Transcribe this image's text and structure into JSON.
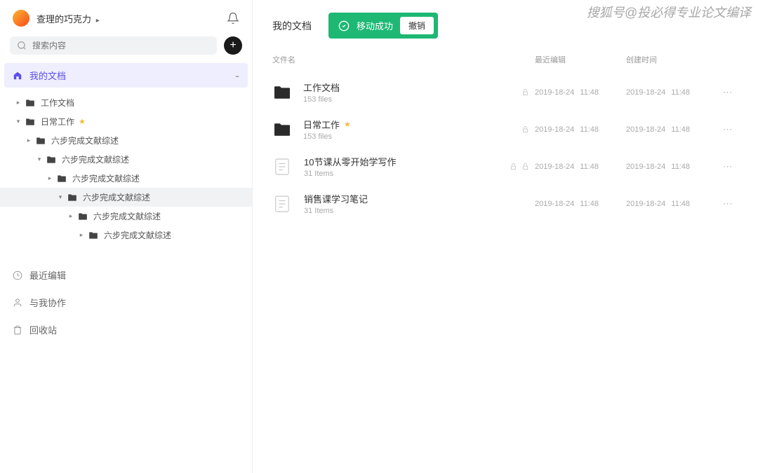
{
  "header": {
    "username": "查理的巧克力",
    "search_placeholder": "搜索内容"
  },
  "nav": {
    "my_docs": "我的文档",
    "recent": "最近编辑",
    "shared": "与我协作",
    "trash": "回收站"
  },
  "tree": [
    {
      "indent": 0,
      "label": "工作文档",
      "expanded": false,
      "starred": false,
      "highlighted": false
    },
    {
      "indent": 0,
      "label": "日常工作",
      "expanded": true,
      "starred": true,
      "highlighted": false
    },
    {
      "indent": 1,
      "label": "六步完成文献综述",
      "expanded": false,
      "starred": false,
      "highlighted": false
    },
    {
      "indent": 2,
      "label": "六步完成文献综述",
      "expanded": true,
      "starred": false,
      "highlighted": false
    },
    {
      "indent": 3,
      "label": "六步完成文献综述",
      "expanded": false,
      "starred": false,
      "highlighted": false
    },
    {
      "indent": 4,
      "label": "六步完成文献综述",
      "expanded": true,
      "starred": false,
      "highlighted": true
    },
    {
      "indent": 5,
      "label": "六步完成文献综述",
      "expanded": false,
      "starred": false,
      "highlighted": false
    },
    {
      "indent": 6,
      "label": "六步完成文献综述",
      "expanded": false,
      "starred": false,
      "highlighted": false
    }
  ],
  "main": {
    "title": "我的文档",
    "toast_msg": "移动成功",
    "undo": "撤销",
    "col_name": "文件名",
    "col_edited": "最近编辑",
    "col_created": "创建时间"
  },
  "files": [
    {
      "type": "folder",
      "name": "工作文档",
      "meta": "153 files",
      "starred": false,
      "locks": 1,
      "date1": "2019-18-24",
      "time1": "11:48",
      "date2": "2019-18-24",
      "time2": "11:48"
    },
    {
      "type": "folder",
      "name": "日常工作",
      "meta": "153 files",
      "starred": true,
      "locks": 1,
      "date1": "2019-18-24",
      "time1": "11:48",
      "date2": "2019-18-24",
      "time2": "11:48"
    },
    {
      "type": "doc",
      "name": "10节课从零开始学写作",
      "meta": "31 Items",
      "starred": false,
      "locks": 2,
      "date1": "2019-18-24",
      "time1": "11:48",
      "date2": "2019-18-24",
      "time2": "11:48"
    },
    {
      "type": "doc",
      "name": "销售课学习笔记",
      "meta": "31 Items",
      "starred": false,
      "locks": 0,
      "date1": "2019-18-24",
      "time1": "11:48",
      "date2": "2019-18-24",
      "time2": "11:48"
    }
  ],
  "watermark": "搜狐号@投必得专业论文编译"
}
